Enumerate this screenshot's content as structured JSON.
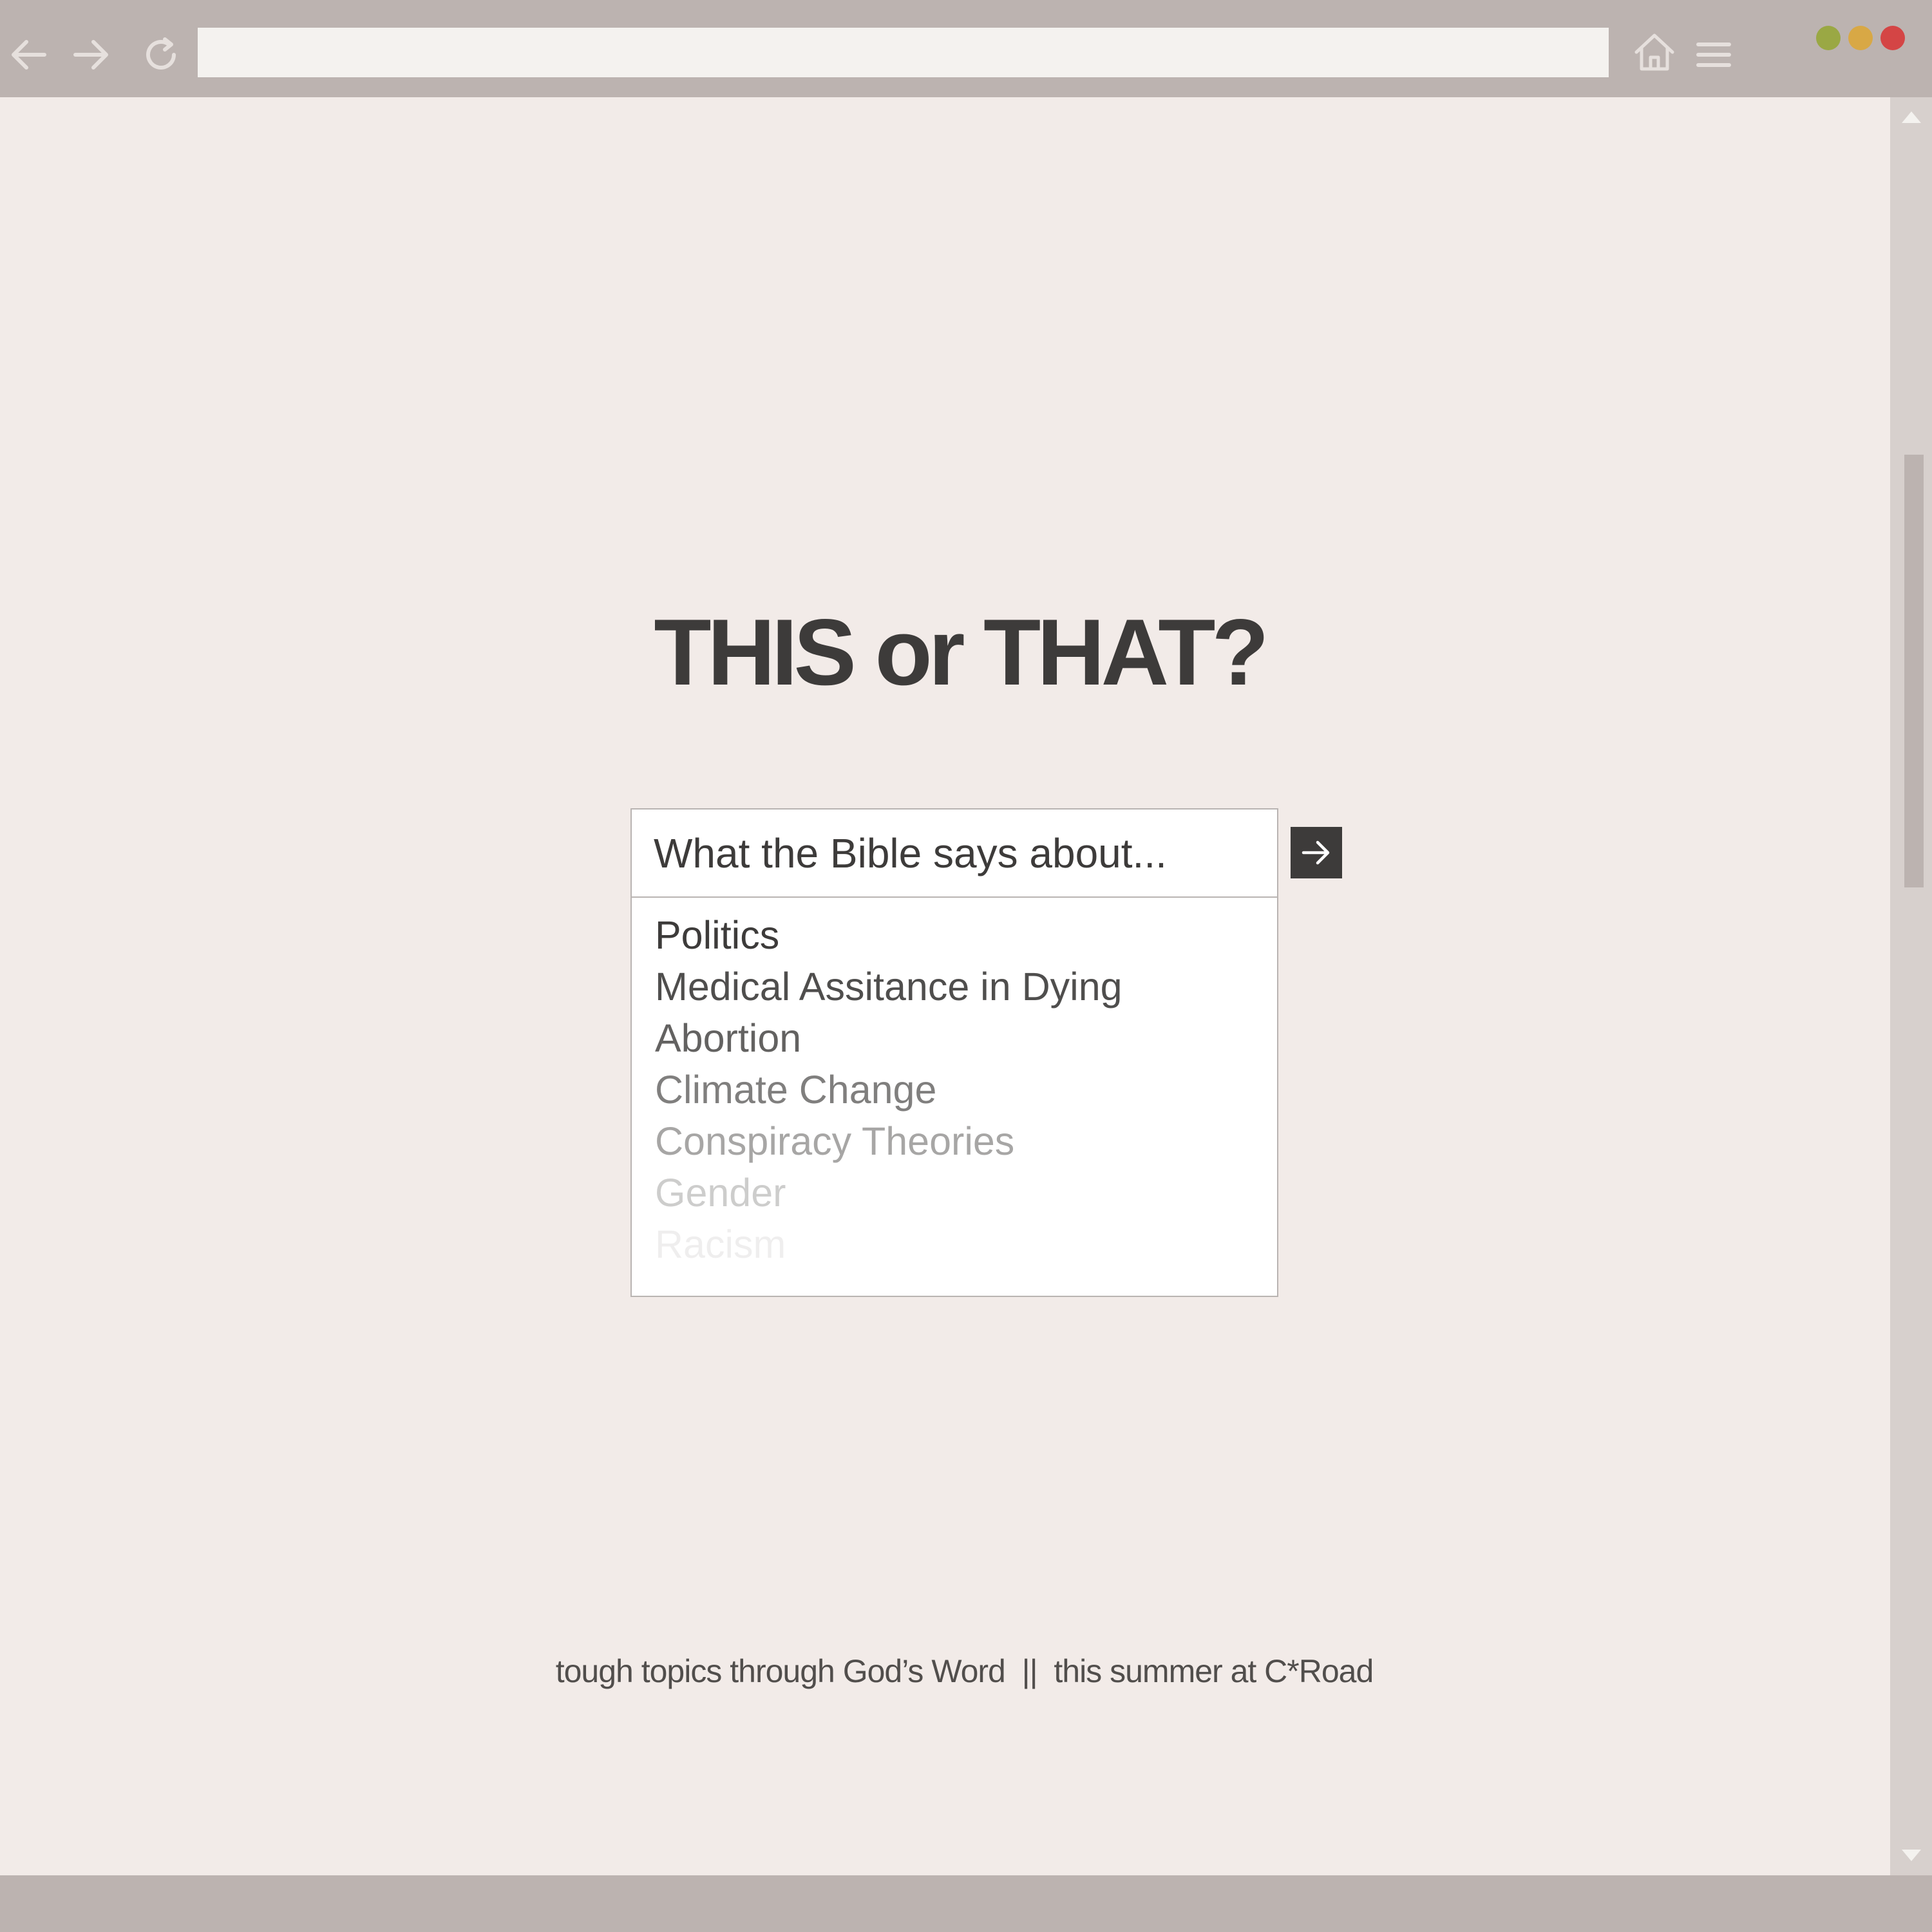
{
  "browser": {
    "address_value": "",
    "icons": {
      "back": "arrow-left-icon",
      "forward": "arrow-right-icon",
      "reload": "reload-icon",
      "home": "home-icon",
      "menu": "hamburger-menu-icon"
    },
    "window_dots": [
      "#9aa844",
      "#d8a845",
      "#d44545"
    ]
  },
  "page": {
    "headline": "THIS or THAT?",
    "search": {
      "placeholder": "What the Bible says about..."
    },
    "suggestions": [
      {
        "label": "Politics",
        "opacity": 1.0
      },
      {
        "label": "Medical Assitance in Dying",
        "opacity": 0.9
      },
      {
        "label": "Abortion",
        "opacity": 0.8
      },
      {
        "label": "Climate Change",
        "opacity": 0.65
      },
      {
        "label": "Conspiracy Theories",
        "opacity": 0.45
      },
      {
        "label": "Gender",
        "opacity": 0.25
      },
      {
        "label": "Racism",
        "opacity": 0.08
      }
    ],
    "footer": "tough topics through God’s Word  ||  this summer at C*Road"
  },
  "colors": {
    "chrome": "#bcb3b0",
    "background": "#f2ebe8",
    "text": "#3d3b3a"
  }
}
